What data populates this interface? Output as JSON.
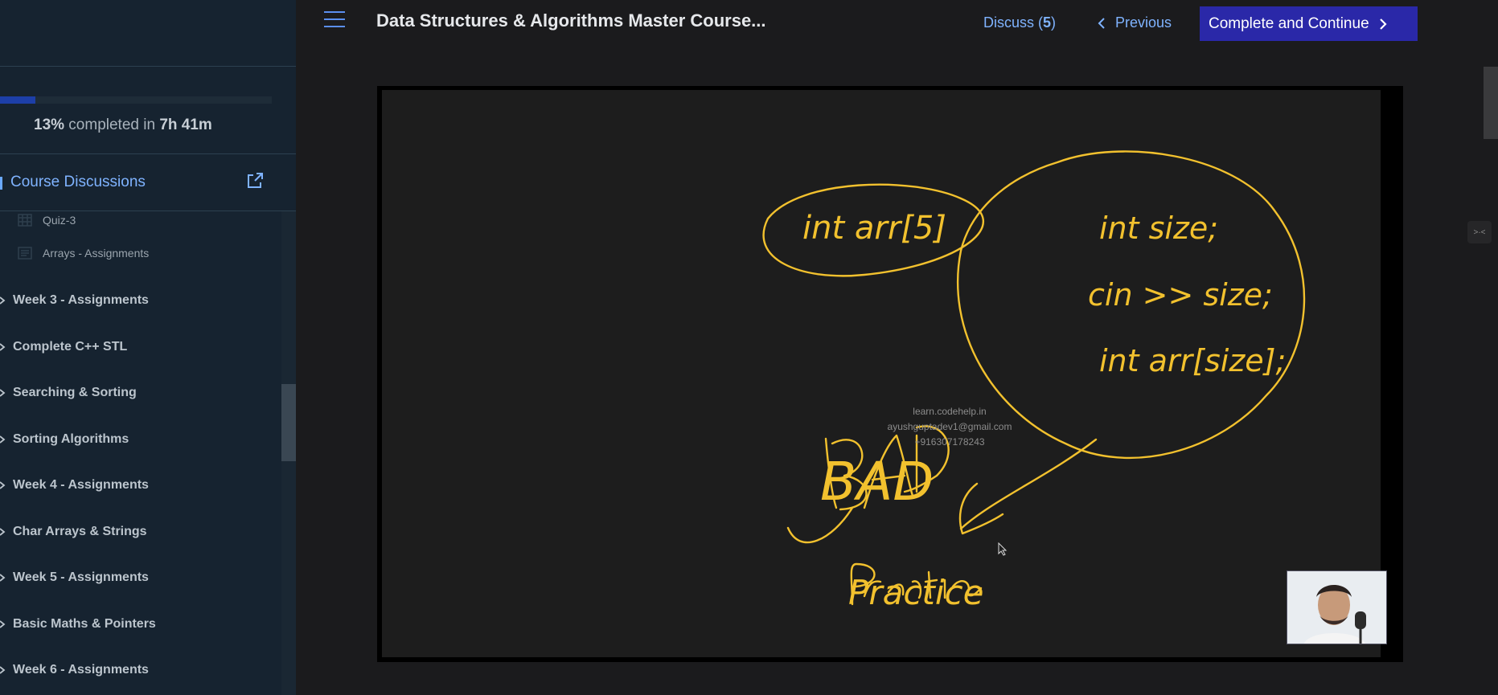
{
  "header": {
    "title": "Data Structures & Algorithms Master Course...",
    "discuss_label": "Discuss (",
    "discuss_count": "5",
    "discuss_suffix": ")",
    "previous_label": "Previous",
    "complete_label": "Complete and Continue"
  },
  "sidebar": {
    "progress": {
      "percent_fraction": 0.13,
      "percent_text": "13%",
      "completed_in_text": " completed in ",
      "time": "7h 41m"
    },
    "discussions_label": "Course Discussions",
    "lessons": [
      {
        "label": "Quiz-3",
        "icon": "quiz-icon"
      },
      {
        "label": "Arrays - Assignments",
        "icon": "assignment-icon"
      }
    ],
    "sections": [
      {
        "label": "Week 3 - Assignments"
      },
      {
        "label": "Complete C++ STL"
      },
      {
        "label": "Searching & Sorting"
      },
      {
        "label": "Sorting Algorithms"
      },
      {
        "label": "Week 4 - Assignments"
      },
      {
        "label": "Char Arrays & Strings"
      },
      {
        "label": "Week 5 - Assignments"
      },
      {
        "label": "Basic Maths & Pointers"
      },
      {
        "label": "Week 6 - Assignments"
      }
    ]
  },
  "video": {
    "watermark": {
      "site": "learn.codehelp.in",
      "email": "ayushguptadev1@gmail.com",
      "phone": "+916307178243"
    },
    "board_text": {
      "left_code": "int arr[5]",
      "right_line1": "int size;",
      "right_line2": "cin >> size;",
      "right_line3": "int arr[size];",
      "bad": "BAD",
      "practice": "Practice"
    },
    "ink_color": "#f2c12e"
  }
}
